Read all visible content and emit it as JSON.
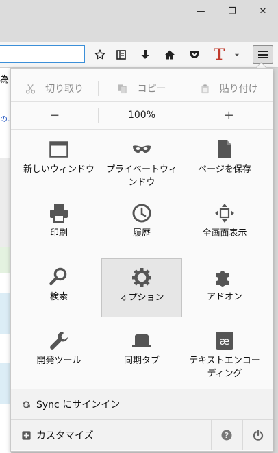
{
  "window_controls": {
    "minimize_glyph": "—",
    "restore_glyph": "❐",
    "close_glyph": "✕"
  },
  "page_behind": {
    "left_char": "為",
    "link_fragment": "の."
  },
  "toolbar": {
    "reader_label": "T"
  },
  "menu": {
    "edit": {
      "cut": "切り取り",
      "copy": "コピー",
      "paste": "貼り付け"
    },
    "zoom": {
      "minus": "−",
      "level": "100%",
      "plus": "+"
    },
    "items": [
      {
        "label": "新しいウィンドウ",
        "icon": "new-window-icon"
      },
      {
        "label": "プライベートウィンドウ",
        "icon": "private-mask-icon"
      },
      {
        "label": "ページを保存",
        "icon": "save-page-icon"
      },
      {
        "label": "印刷",
        "icon": "print-icon"
      },
      {
        "label": "履歴",
        "icon": "history-clock-icon"
      },
      {
        "label": "全画面表示",
        "icon": "fullscreen-icon"
      },
      {
        "label": "検索",
        "icon": "search-icon"
      },
      {
        "label": "オプション",
        "icon": "gear-icon"
      },
      {
        "label": "アドオン",
        "icon": "puzzle-icon"
      },
      {
        "label": "開発ツール",
        "icon": "wrench-icon"
      },
      {
        "label": "同期タブ",
        "icon": "synced-tabs-icon"
      },
      {
        "label": "テキストエンコーディング",
        "icon": "text-encoding-icon"
      }
    ],
    "sync_label": "Sync にサインイン",
    "customize_label": "カスタマイズ"
  }
}
